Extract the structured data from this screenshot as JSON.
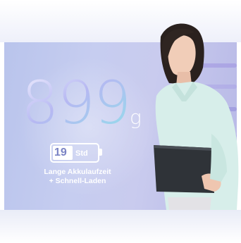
{
  "weight": {
    "value": "899",
    "unit": "g"
  },
  "battery": {
    "hours": "19",
    "unit_label": "Std"
  },
  "caption": {
    "line1": "Lange Akkulaufzeit",
    "line2": "+ Schnell-Laden"
  },
  "colors": {
    "banner": "#c4caf0",
    "digits_left": "#9aa4ea",
    "digits_right": "#7fd8e6",
    "badge_text": "#7a83c4",
    "shirt": "#d7eeea",
    "laptop": "#2f3338"
  }
}
